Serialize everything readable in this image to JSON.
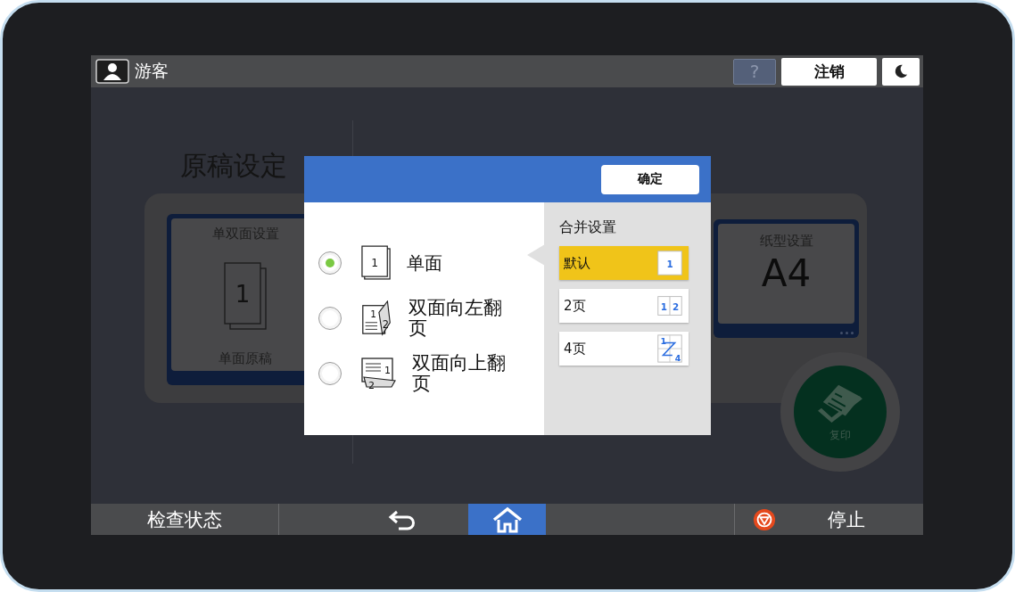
{
  "top_bar": {
    "user": "游客",
    "help": "?",
    "logout": "注销"
  },
  "background": {
    "left_title": "原稿设定",
    "duplex_card": {
      "title": "单双面设置",
      "icon_number": "1",
      "value": "单面原稿"
    },
    "paper_card": {
      "title": "纸型设置",
      "value": "A4"
    },
    "copy_button": "复印"
  },
  "dialog": {
    "confirm": "确定",
    "options": [
      {
        "kind": "single",
        "label": "单面",
        "selected": true,
        "numbers": [
          "1"
        ]
      },
      {
        "kind": "left",
        "label": "双面向左翻页",
        "selected": false,
        "numbers": [
          "1",
          "2"
        ]
      },
      {
        "kind": "top",
        "label": "双面向上翻页",
        "selected": false,
        "numbers": [
          "1",
          "2"
        ]
      }
    ],
    "merge": {
      "title": "合并设置",
      "items": [
        {
          "kind": "one",
          "label": "默认",
          "selected": true,
          "numbers": [
            "1"
          ]
        },
        {
          "kind": "two",
          "label": "2页",
          "selected": false,
          "numbers": [
            "1",
            "2"
          ]
        },
        {
          "kind": "four",
          "label": "4页",
          "selected": false,
          "numbers": [
            "1",
            "4"
          ]
        }
      ]
    }
  },
  "bottom_bar": [
    {
      "kind": "status",
      "label": "检查状态",
      "selected": false
    },
    {
      "kind": "back",
      "selected": false
    },
    {
      "kind": "home",
      "selected": true
    },
    {
      "kind": "blank",
      "selected": false
    },
    {
      "kind": "stop",
      "label": "停止",
      "selected": false
    }
  ]
}
